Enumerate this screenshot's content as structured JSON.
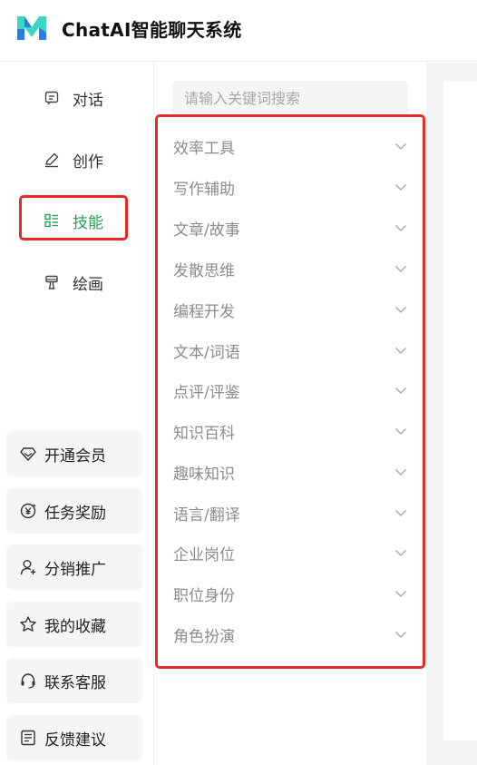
{
  "app": {
    "title": "ChatAI智能聊天系统"
  },
  "brand_colors": {
    "accent": "#22a35a",
    "logo_blue": "#2a7de1",
    "logo_teal": "#3bd6c6",
    "highlight": "#e52b25"
  },
  "sidebar": {
    "nav": [
      {
        "label": "对话",
        "icon": "chat-icon",
        "active": false
      },
      {
        "label": "创作",
        "icon": "pencil-icon",
        "active": false
      },
      {
        "label": "技能",
        "icon": "skills-list-icon",
        "active": true
      },
      {
        "label": "绘画",
        "icon": "paintbrush-icon",
        "active": false
      }
    ],
    "bottom": [
      {
        "label": "开通会员",
        "icon": "diamond-icon"
      },
      {
        "label": "任务奖励",
        "icon": "coin-icon"
      },
      {
        "label": "分销推广",
        "icon": "user-add-icon"
      },
      {
        "label": "我的收藏",
        "icon": "star-icon"
      },
      {
        "label": "联系客服",
        "icon": "headset-icon"
      },
      {
        "label": "反馈建议",
        "icon": "feedback-icon"
      }
    ]
  },
  "skills": {
    "search_placeholder": "请输入关键词搜索",
    "categories": [
      "效率工具",
      "写作辅助",
      "文章/故事",
      "发散思维",
      "编程开发",
      "文本/词语",
      "点评/评鉴",
      "知识百科",
      "趣味知识",
      "语言/翻译",
      "企业岗位",
      "职位身份",
      "角色扮演"
    ]
  }
}
